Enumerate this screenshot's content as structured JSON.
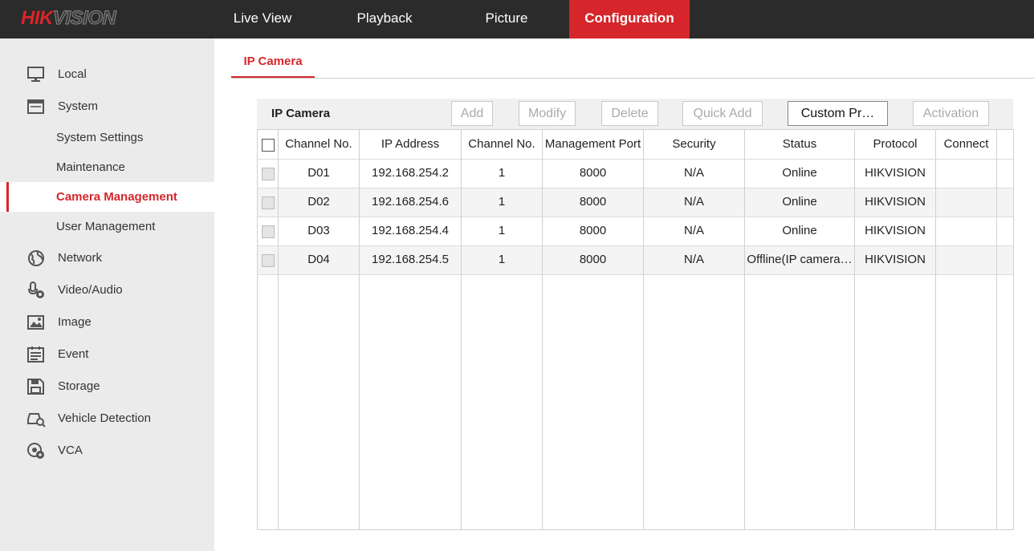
{
  "brand": {
    "logo_part1": "HIK",
    "logo_part2": "VISION"
  },
  "nav": {
    "live_view": "Live View",
    "playback": "Playback",
    "picture": "Picture",
    "configuration": "Configuration"
  },
  "sidebar": {
    "local": "Local",
    "system": "System",
    "system_settings": "System Settings",
    "maintenance": "Maintenance",
    "camera_management": "Camera Management",
    "user_management": "User Management",
    "network": "Network",
    "video_audio": "Video/Audio",
    "image": "Image",
    "event": "Event",
    "storage": "Storage",
    "vehicle_detection": "Vehicle Detection",
    "vca": "VCA"
  },
  "tab": {
    "label": "IP Camera"
  },
  "toolbar": {
    "title": "IP Camera",
    "add": "Add",
    "modify": "Modify",
    "delete": "Delete",
    "quick_add": "Quick Add",
    "custom_protocol": "Custom Pr…",
    "activation": "Activation"
  },
  "table": {
    "headers": {
      "channel_no": "Channel No.",
      "ip_address": "IP Address",
      "channel_no2": "Channel No.",
      "management_port": "Management Port",
      "security": "Security",
      "status": "Status",
      "protocol": "Protocol",
      "connect": "Connect"
    },
    "rows": [
      {
        "channel": "D01",
        "ip": "192.168.254.2",
        "ch": "1",
        "port": "8000",
        "security": "N/A",
        "status": "Online",
        "protocol": "HIKVISION"
      },
      {
        "channel": "D02",
        "ip": "192.168.254.6",
        "ch": "1",
        "port": "8000",
        "security": "N/A",
        "status": "Online",
        "protocol": "HIKVISION"
      },
      {
        "channel": "D03",
        "ip": "192.168.254.4",
        "ch": "1",
        "port": "8000",
        "security": "N/A",
        "status": "Online",
        "protocol": "HIKVISION"
      },
      {
        "channel": "D04",
        "ip": "192.168.254.5",
        "ch": "1",
        "port": "8000",
        "security": "N/A",
        "status": "Offline(IP camera…",
        "protocol": "HIKVISION"
      }
    ]
  },
  "colors": {
    "accent": "#d6262b",
    "topbar": "#2b2b2b",
    "sidebar": "#ebebeb"
  }
}
